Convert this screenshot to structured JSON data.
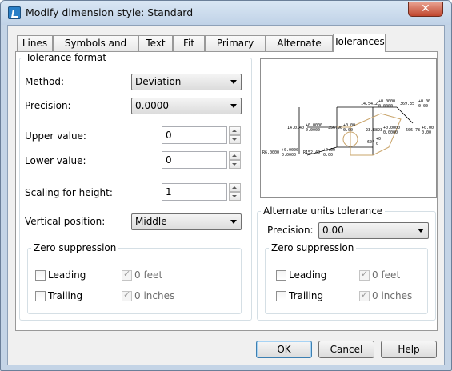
{
  "window": {
    "title": "Modify dimension style: Standard",
    "close_label": "✕"
  },
  "tabs": [
    {
      "label": "Lines"
    },
    {
      "label": "Symbols and arrows"
    },
    {
      "label": "Text"
    },
    {
      "label": "Fit"
    },
    {
      "label": "Primary units"
    },
    {
      "label": "Alternate units"
    },
    {
      "label": "Tolerances",
      "active": true
    }
  ],
  "tolerance_format": {
    "title": "Tolerance format",
    "method_label": "Method:",
    "method_value": "Deviation",
    "precision_label": "Precision:",
    "precision_value": "0.0000",
    "upper_label": "Upper value:",
    "upper_value": "0",
    "lower_label": "Lower value:",
    "lower_value": "0",
    "scaling_label": "Scaling for height:",
    "scaling_value": "1",
    "vertical_label": "Vertical position:",
    "vertical_value": "Middle",
    "zero_suppression": {
      "title": "Zero suppression",
      "leading": "Leading",
      "trailing": "Trailing",
      "feet": "0 feet",
      "inches": "0 inches"
    }
  },
  "alternate_units_tolerance": {
    "title": "Alternate units tolerance",
    "precision_label": "Precision:",
    "precision_value": "0.00",
    "zero_suppression": {
      "title": "Zero suppression",
      "leading": "Leading",
      "trailing": "Trailing",
      "feet": "0 feet",
      "inches": "0 inches"
    }
  },
  "preview": {
    "t1": "14.5412",
    "t1a": "+0.0000",
    "t1b": "0.0000",
    "t2": "369.35",
    "t2a": "+0.00",
    "t2b": "0.00",
    "t3": "14.0140",
    "t3a": "+0.0000",
    "t3b": "0.0000",
    "t4": "356.96",
    "t4a": "+0.00",
    "t4b": "0.00",
    "t5": "23.8893",
    "t5a": "+0.0000",
    "t5b": "0.0000",
    "t6": "606.78",
    "t6a": "+0.00",
    "t6b": "0.00",
    "t7": "R6.0000",
    "t7a": "+0.0000",
    "t7b": "0.0000",
    "t8": "R152.40",
    "t8a": "+0.00",
    "t8b": "0.00",
    "t9": "60°",
    "t9a": "+0",
    "t9b": "0"
  },
  "buttons": {
    "ok": "OK",
    "cancel": "Cancel",
    "help": "Help"
  }
}
